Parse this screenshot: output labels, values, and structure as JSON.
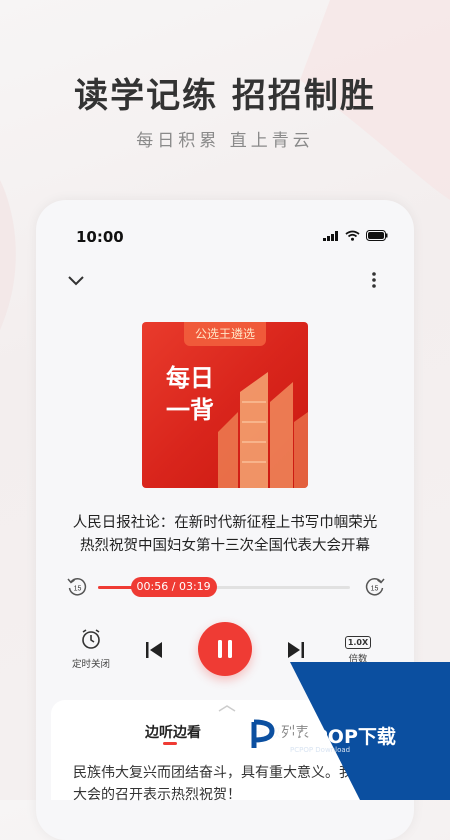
{
  "headline": "读学记练  招招制胜",
  "subline": "每日积累   直上青云",
  "status_bar": {
    "time": "10:00"
  },
  "player": {
    "cover_tag": "公选王遴选",
    "cover_title": "每日一背",
    "track_title_line1": "人民日报社论：在新时代新征程上书写巾帼荣光",
    "track_title_line2": "热烈祝贺中国妇女第十三次全国代表大会开幕",
    "time_display": "00:56 / 03:19",
    "progress": 0.28,
    "skip_back_seconds": "15",
    "skip_forward_seconds": "15",
    "timer_label": "定时关闭",
    "speed_value": "1.0X",
    "speed_label": "倍数"
  },
  "tabs": [
    {
      "label": "边听边看",
      "active": true
    },
    {
      "label": "播放列表",
      "active": false
    }
  ],
  "lyric_text": "民族伟大复兴而团结奋斗，具有重大意义。我们对大会的召开表示热烈祝贺！",
  "watermark": {
    "brand": "PCPOP下载",
    "sub": "PCPOP Download"
  },
  "colors": {
    "accent": "#ef3b34",
    "watermark_blue": "#0b4fa0"
  }
}
